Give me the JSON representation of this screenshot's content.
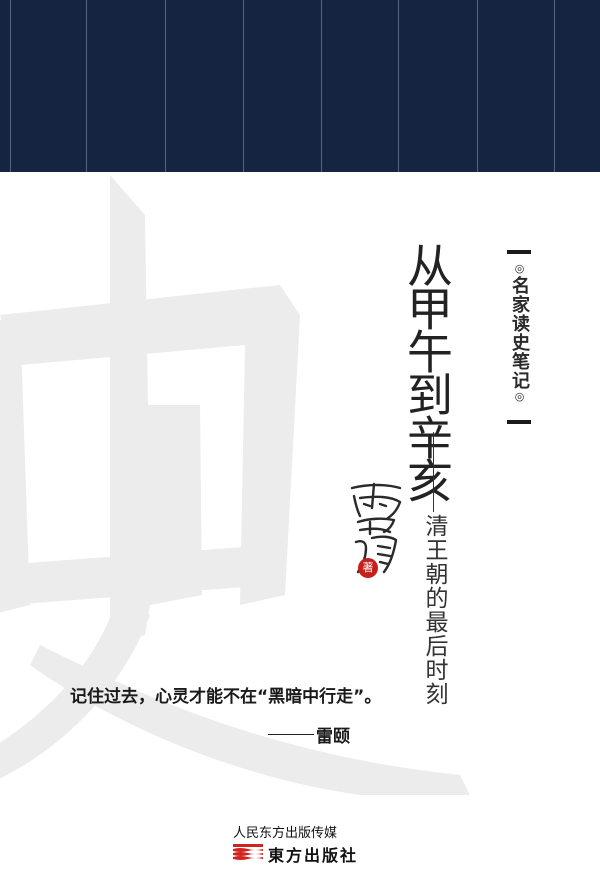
{
  "book": {
    "series_label": "名家读史笔记",
    "series_dot": "◎",
    "title": "从甲午到辛亥",
    "subtitle": "清王朝的最后时刻",
    "author_signature": "雷颐",
    "seal_text": "著",
    "background_character": "史",
    "quote": "记住过去，心灵才能不在“黑暗中行走”。",
    "quote_author": "雷颐",
    "publisher_line": "人民东方出版传媒",
    "publisher_name": "東方出版社"
  },
  "colors": {
    "top_band": "#152440",
    "background_char": "#ececec",
    "seal_red": "#c5201c",
    "logo_red": "#d0241f"
  }
}
